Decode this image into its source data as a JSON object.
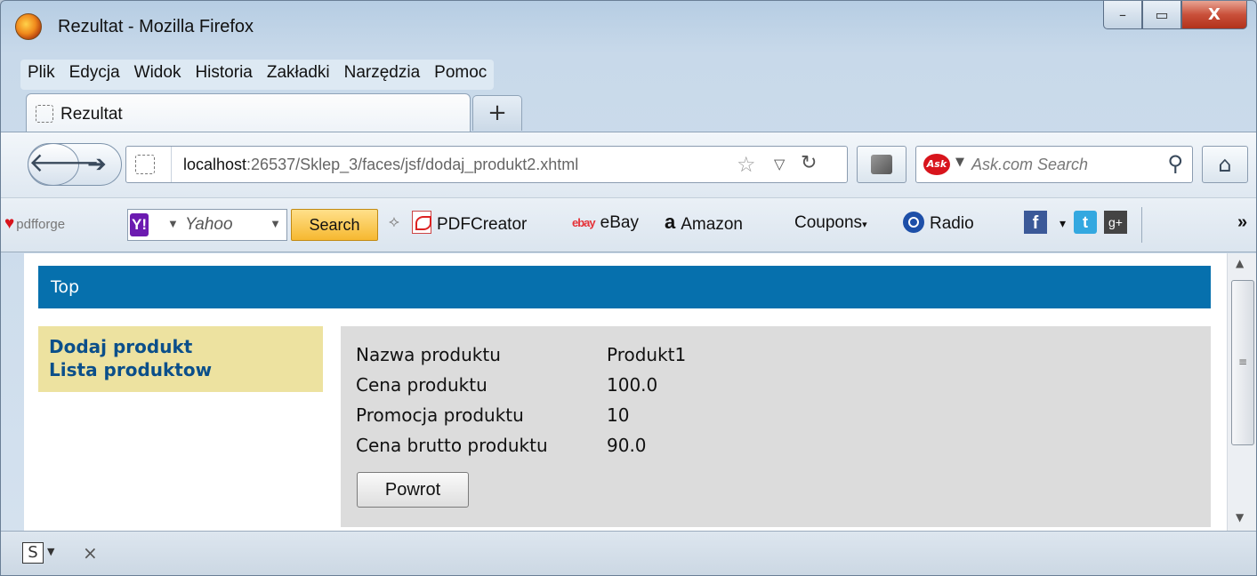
{
  "window": {
    "title": "Rezultat - Mozilla Firefox",
    "controls": {
      "minimize": "–",
      "maximize": "▭",
      "close": "X"
    }
  },
  "menu": [
    "Plik",
    "Edycja",
    "Widok",
    "Historia",
    "Zakładki",
    "Narzędzia",
    "Pomoc"
  ],
  "tab": {
    "label": "Rezultat",
    "new_tab": "+"
  },
  "nav": {
    "url_host": "localhost",
    "url_rest": ":26537/Sklep_3/faces/jsf/dodaj_produkt2.xhtml",
    "search_placeholder": "Ask.com Search",
    "ask_logo": "Ask"
  },
  "bookmarks": {
    "pdfforge": "pdfforge",
    "yahoo_placeholder": "Yahoo",
    "search_button": "Search",
    "items": [
      "PDFCreator",
      "eBay",
      "Amazon",
      "Coupons",
      "Radio"
    ],
    "ebay_icon": "ebay",
    "amazon_icon": "a",
    "fb_icon": "f",
    "tw_icon": "t",
    "gp_icon": "g+"
  },
  "page": {
    "banner": "Top",
    "menu_links": [
      "Dodaj produkt",
      "Lista produktow"
    ],
    "rows": [
      {
        "label": "Nazwa produktu",
        "value": "Produkt1"
      },
      {
        "label": "Cena produktu",
        "value": "100.0"
      },
      {
        "label": "Promocja produktu",
        "value": "10"
      },
      {
        "label": "Cena brutto produktu",
        "value": "90.0"
      }
    ],
    "back_button": "Powrot"
  },
  "addon_bar": {
    "s_icon": "S",
    "close": "×"
  },
  "colors": {
    "banner": "#0670ad",
    "left_menu": "#ede2a0",
    "content_box": "#dcdcdc",
    "link": "#0b4f8a"
  }
}
